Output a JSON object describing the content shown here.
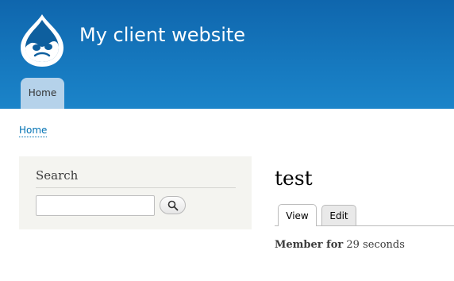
{
  "header": {
    "site_name": "My client website",
    "logo_icon": "drupal-drop-icon",
    "nav": [
      {
        "label": "Home",
        "active": true
      }
    ],
    "colors": {
      "gradient_top": "#0f66ad",
      "gradient_bottom": "#1b84c9",
      "active_tab": "#b5d2ea"
    }
  },
  "breadcrumb": {
    "items": [
      {
        "label": "Home"
      }
    ]
  },
  "sidebar": {
    "search_block": {
      "title": "Search",
      "input_value": "",
      "button_icon": "search-icon"
    }
  },
  "main": {
    "title": "test",
    "tabs": [
      {
        "label": "View",
        "active": true
      },
      {
        "label": "Edit",
        "active": false
      }
    ],
    "member_for": {
      "label": "Member for",
      "value": "29 seconds"
    }
  }
}
